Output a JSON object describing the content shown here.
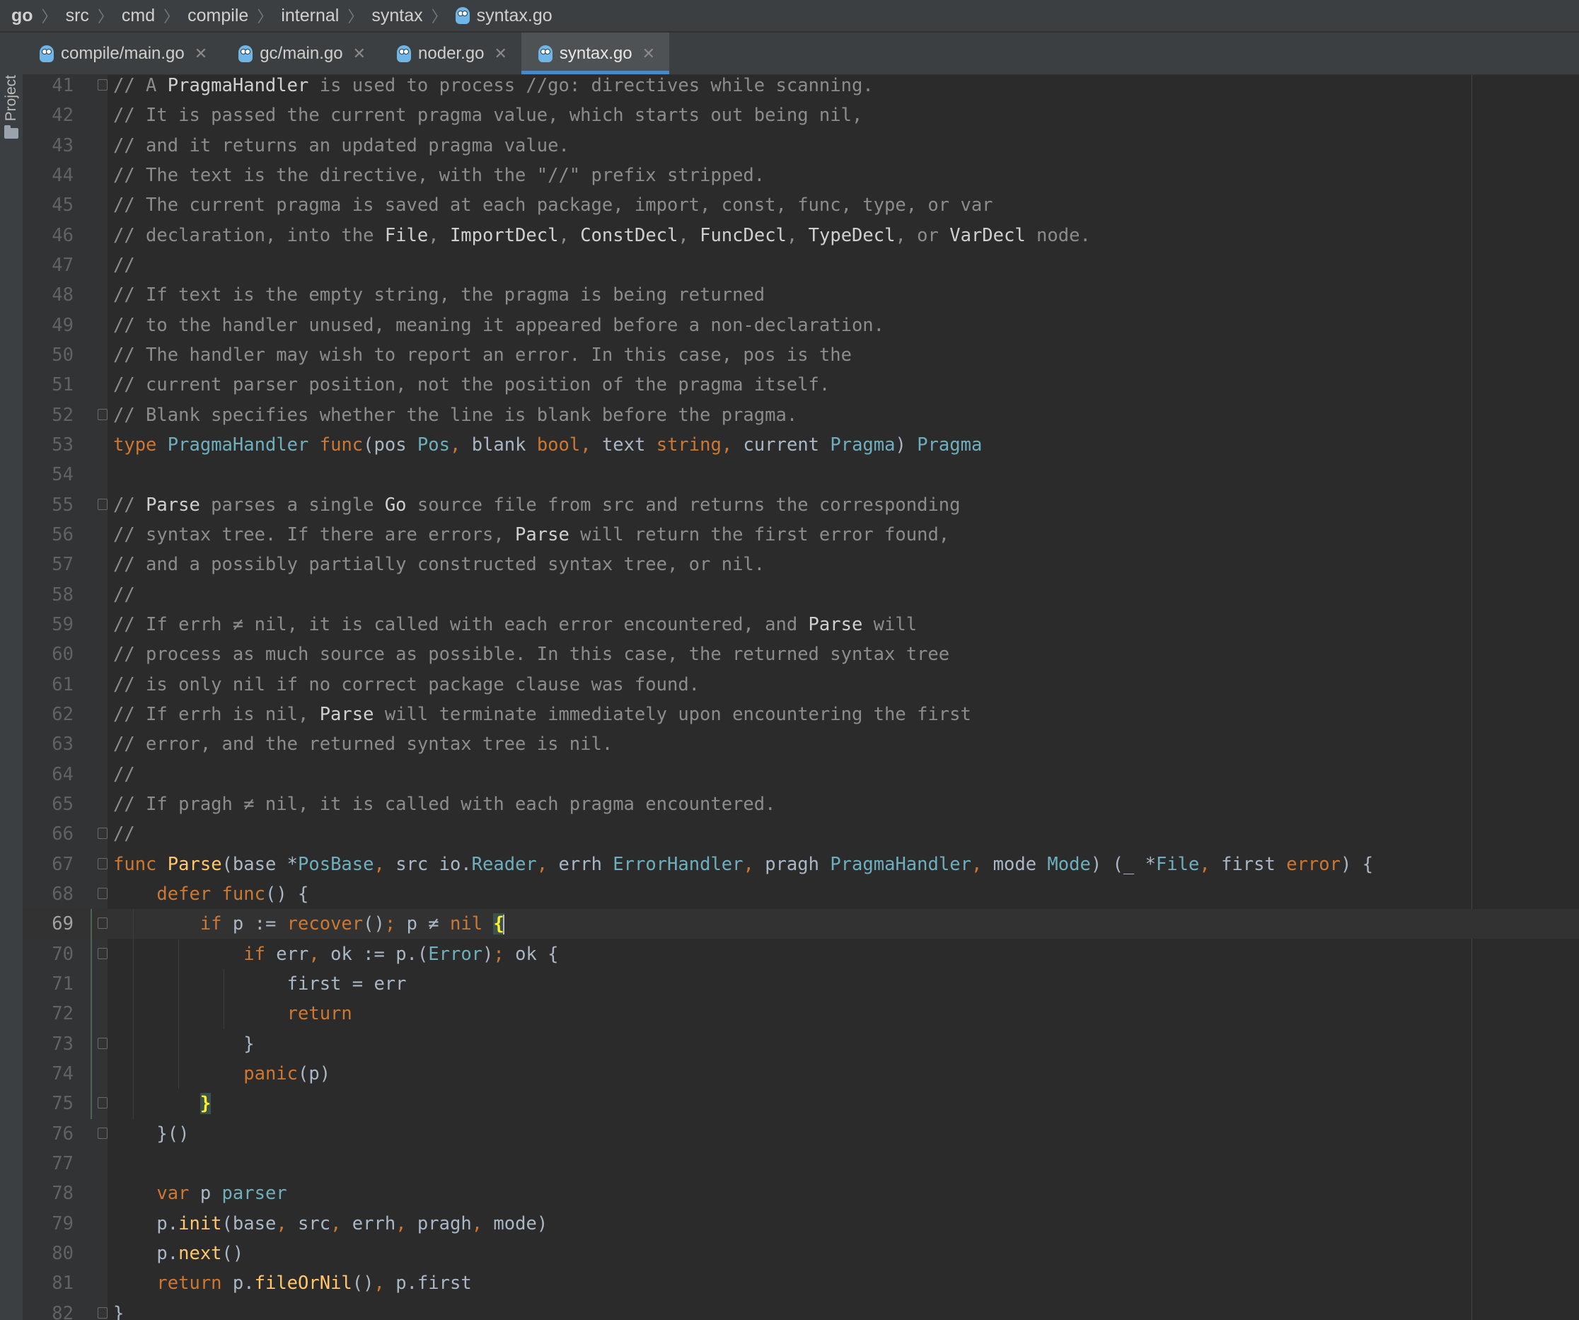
{
  "breadcrumb": [
    "go",
    "src",
    "cmd",
    "compile",
    "internal",
    "syntax",
    "syntax.go"
  ],
  "toolstrip": {
    "project_label": "Project"
  },
  "tabs": [
    {
      "label": "compile/main.go",
      "active": false
    },
    {
      "label": "gc/main.go",
      "active": false
    },
    {
      "label": "noder.go",
      "active": false
    },
    {
      "label": "syntax.go",
      "active": true
    }
  ],
  "editor": {
    "current_line": 69,
    "lines": [
      {
        "n": 41,
        "text": "// A PragmaHandler is used to process //go: directives while scanning."
      },
      {
        "n": 42,
        "text": "// It is passed the current pragma value, which starts out being nil,"
      },
      {
        "n": 43,
        "text": "// and it returns an updated pragma value."
      },
      {
        "n": 44,
        "text": "// The text is the directive, with the \"//\" prefix stripped."
      },
      {
        "n": 45,
        "text": "// The current pragma is saved at each package, import, const, func, type, or var"
      },
      {
        "n": 46,
        "text": "// declaration, into the File, ImportDecl, ConstDecl, FuncDecl, TypeDecl, or VarDecl node."
      },
      {
        "n": 47,
        "text": "//"
      },
      {
        "n": 48,
        "text": "// If text is the empty string, the pragma is being returned"
      },
      {
        "n": 49,
        "text": "// to the handler unused, meaning it appeared before a non-declaration."
      },
      {
        "n": 50,
        "text": "// The handler may wish to report an error. In this case, pos is the"
      },
      {
        "n": 51,
        "text": "// current parser position, not the position of the pragma itself."
      },
      {
        "n": 52,
        "text": "// Blank specifies whether the line is blank before the pragma."
      },
      {
        "n": 53,
        "text": "type PragmaHandler func(pos Pos, blank bool, text string, current Pragma) Pragma"
      },
      {
        "n": 54,
        "text": ""
      },
      {
        "n": 55,
        "text": "// Parse parses a single Go source file from src and returns the corresponding"
      },
      {
        "n": 56,
        "text": "// syntax tree. If there are errors, Parse will return the first error found,"
      },
      {
        "n": 57,
        "text": "// and a possibly partially constructed syntax tree, or nil."
      },
      {
        "n": 58,
        "text": "//"
      },
      {
        "n": 59,
        "text": "// If errh ≠ nil, it is called with each error encountered, and Parse will"
      },
      {
        "n": 60,
        "text": "// process as much source as possible. In this case, the returned syntax tree"
      },
      {
        "n": 61,
        "text": "// is only nil if no correct package clause was found."
      },
      {
        "n": 62,
        "text": "// If errh is nil, Parse will terminate immediately upon encountering the first"
      },
      {
        "n": 63,
        "text": "// error, and the returned syntax tree is nil."
      },
      {
        "n": 64,
        "text": "//"
      },
      {
        "n": 65,
        "text": "// If pragh ≠ nil, it is called with each pragma encountered."
      },
      {
        "n": 66,
        "text": "//"
      },
      {
        "n": 67,
        "text": "func Parse(base *PosBase, src io.Reader, errh ErrorHandler, pragh PragmaHandler, mode Mode) (_ *File, first error) {"
      },
      {
        "n": 68,
        "text": "    defer func() {"
      },
      {
        "n": 69,
        "text": "        if p := recover(); p ≠ nil {"
      },
      {
        "n": 70,
        "text": "            if err, ok := p.(Error); ok {"
      },
      {
        "n": 71,
        "text": "                first = err"
      },
      {
        "n": 72,
        "text": "                return"
      },
      {
        "n": 73,
        "text": "            }"
      },
      {
        "n": 74,
        "text": "            panic(p)"
      },
      {
        "n": 75,
        "text": "        }"
      },
      {
        "n": 76,
        "text": "    }()"
      },
      {
        "n": 77,
        "text": ""
      },
      {
        "n": 78,
        "text": "    var p parser"
      },
      {
        "n": 79,
        "text": "    p.init(base, src, errh, pragh, mode)"
      },
      {
        "n": 80,
        "text": "    p.next()"
      },
      {
        "n": 81,
        "text": "    return p.fileOrNil(), p.first"
      },
      {
        "n": 82,
        "text": "}"
      }
    ]
  },
  "colors": {
    "background": "#2b2b2b",
    "keyword": "#cc7832",
    "comment": "#8c8c8c",
    "type": "#6fafbd",
    "function": "#ffc66d",
    "active_tab_underline": "#4a88c7"
  }
}
